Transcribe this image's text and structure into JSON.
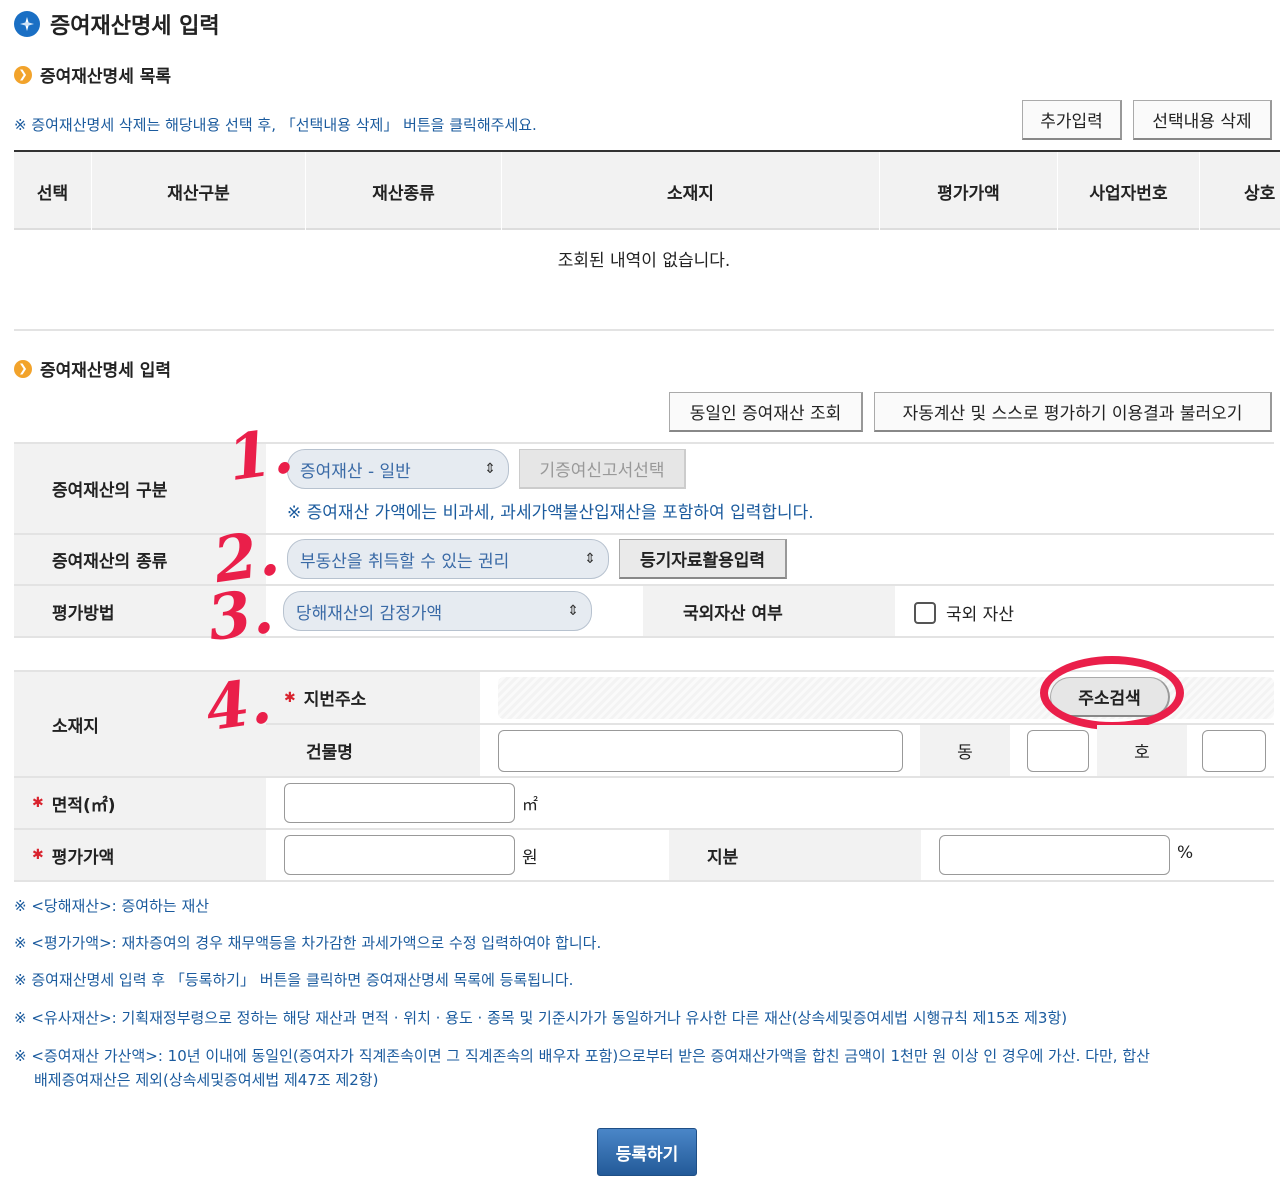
{
  "page": {
    "title": "증여재산명세 입력"
  },
  "list_section": {
    "title": "증여재산명세 목록",
    "note": "※ 증여재산명세 삭제는 해당내용 선택 후, 「선택내용 삭제」 버튼을 클릭해주세요.",
    "add_button": "추가입력",
    "delete_button": "선택내용 삭제",
    "columns": [
      "선택",
      "재산구분",
      "재산종류",
      "소재지",
      "평가가액",
      "사업자번호",
      "상호"
    ],
    "empty_message": "조회된 내역이 없습니다."
  },
  "input_section": {
    "title": "증여재산명세 입력",
    "same_person_button": "동일인 증여재산 조회",
    "auto_calc_button": "자동계산 및 스스로 평가하기 이용결과 불러오기",
    "category_label": "증여재산의 구분",
    "category_value": "증여재산 - 일반",
    "prev_report_button": "기증여신고서선택",
    "category_note": "※ 증여재산 가액에는 비과세, 과세가액불산입재산을 포함하여 입력합니다.",
    "type_label": "증여재산의 종류",
    "type_value": "부동산을 취득할 수 있는 권리",
    "registry_button": "등기자료활용입력",
    "method_label": "평가방법",
    "method_value": "당해재산의 감정가액",
    "foreign_label": "국외자산 여부",
    "foreign_checkbox_label": "국외 자산",
    "location_label": "소재지",
    "lot_address_label": "지번주소",
    "address_search_button": "주소검색",
    "building_label": "건물명",
    "dong_label": "동",
    "ho_label": "호",
    "area_label": "면적(㎡)",
    "area_unit": "㎡",
    "value_label": "평가가액",
    "value_unit": "원",
    "share_label": "지분",
    "share_unit": "%"
  },
  "notes": [
    "※ <당해재산>: 증여하는 재산",
    "※ <평가가액>: 재차증여의 경우 채무액등을 차가감한 과세가액으로 수정 입력하여야 합니다.",
    "※ 증여재산명세 입력 후 「등록하기」 버튼을 클릭하면 증여재산명세 목록에 등록됩니다.",
    "※ <유사재산>: 기획재정부령으로 정하는 해당 재산과 면적 · 위치 · 용도 · 종목 및 기준시가가 동일하거나 유사한 다른 재산(상속세및증여세법 시행규칙 제15조 제3항)",
    "※ <증여재산 가산액>: 10년 이내에 동일인(증여자가 직계존속이면 그 직계존속의 배우자 포함)으로부터 받은 증여재산가액을 합친 금액이 1천만 원 이상 인 경우에 가산. 다만, 합산",
    "배제증여재산은 제외(상속세및증여세법 제47조 제2항)"
  ],
  "register_button": "등록하기",
  "annotations": [
    "1.",
    "2.",
    "3.",
    "4."
  ],
  "colors": {
    "accent_blue": "#1b5b9e",
    "annotation_red": "#ea1f4a",
    "register_button": "#2e6bb0"
  }
}
